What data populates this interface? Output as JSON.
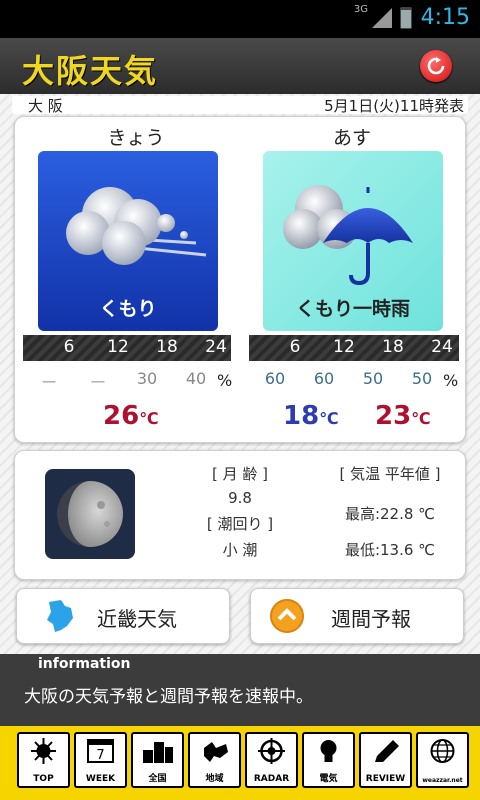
{
  "status_bar": {
    "network": "3G",
    "time": "4:15"
  },
  "header": {
    "title": "大阪天気"
  },
  "location": {
    "city": "大 阪",
    "issued": "5月1日(火)11時発表"
  },
  "forecast": {
    "today": {
      "day_label": "きょう",
      "weather": "くもり",
      "hours": [
        "6",
        "12",
        "18",
        "24"
      ],
      "rain_chance": [
        "ー",
        "ー",
        "30",
        "40"
      ],
      "percent_unit": "%",
      "temp": "26",
      "temp_unit": "℃",
      "colors": {
        "panel": "#1d45c8",
        "temp": "#b01030"
      }
    },
    "tomorrow": {
      "day_label": "あす",
      "weather": "くもり一時雨",
      "hours": [
        "6",
        "12",
        "18",
        "24"
      ],
      "rain_chance": [
        "60",
        "60",
        "50",
        "50"
      ],
      "percent_unit": "%",
      "min_temp": "18",
      "max_temp": "23",
      "temp_unit": "℃",
      "colors": {
        "panel": "#7fe8e0",
        "min_temp": "#2b3db0",
        "max_temp": "#b01030"
      }
    }
  },
  "moon": {
    "age_label": "[ 月 齢 ]",
    "age": "9.8",
    "tide_label": "[ 潮回り ]",
    "tide": "小 潮",
    "normal_label": "[ 気温 平年値 ]",
    "normal_high": "最高:22.8 ℃",
    "normal_low": "最低:13.6 ℃"
  },
  "buttons": {
    "regional": "近畿天気",
    "weekly": "週間予報"
  },
  "info": {
    "heading": "information",
    "text": "大阪の天気予報と週間予報を速報中。"
  },
  "tabs": [
    {
      "label": "TOP",
      "icon": "sun-icon"
    },
    {
      "label": "WEEK",
      "icon": "calendar-7-icon"
    },
    {
      "label": "全国",
      "icon": "buildings-icon"
    },
    {
      "label": "地域",
      "icon": "hokkaido-map-icon"
    },
    {
      "label": "RADAR",
      "icon": "crosshair-icon"
    },
    {
      "label": "電気",
      "icon": "lightbulb-icon"
    },
    {
      "label": "REVIEW",
      "icon": "pencil-icon"
    },
    {
      "label": "weazzar.net",
      "icon": "globe-icon"
    }
  ]
}
